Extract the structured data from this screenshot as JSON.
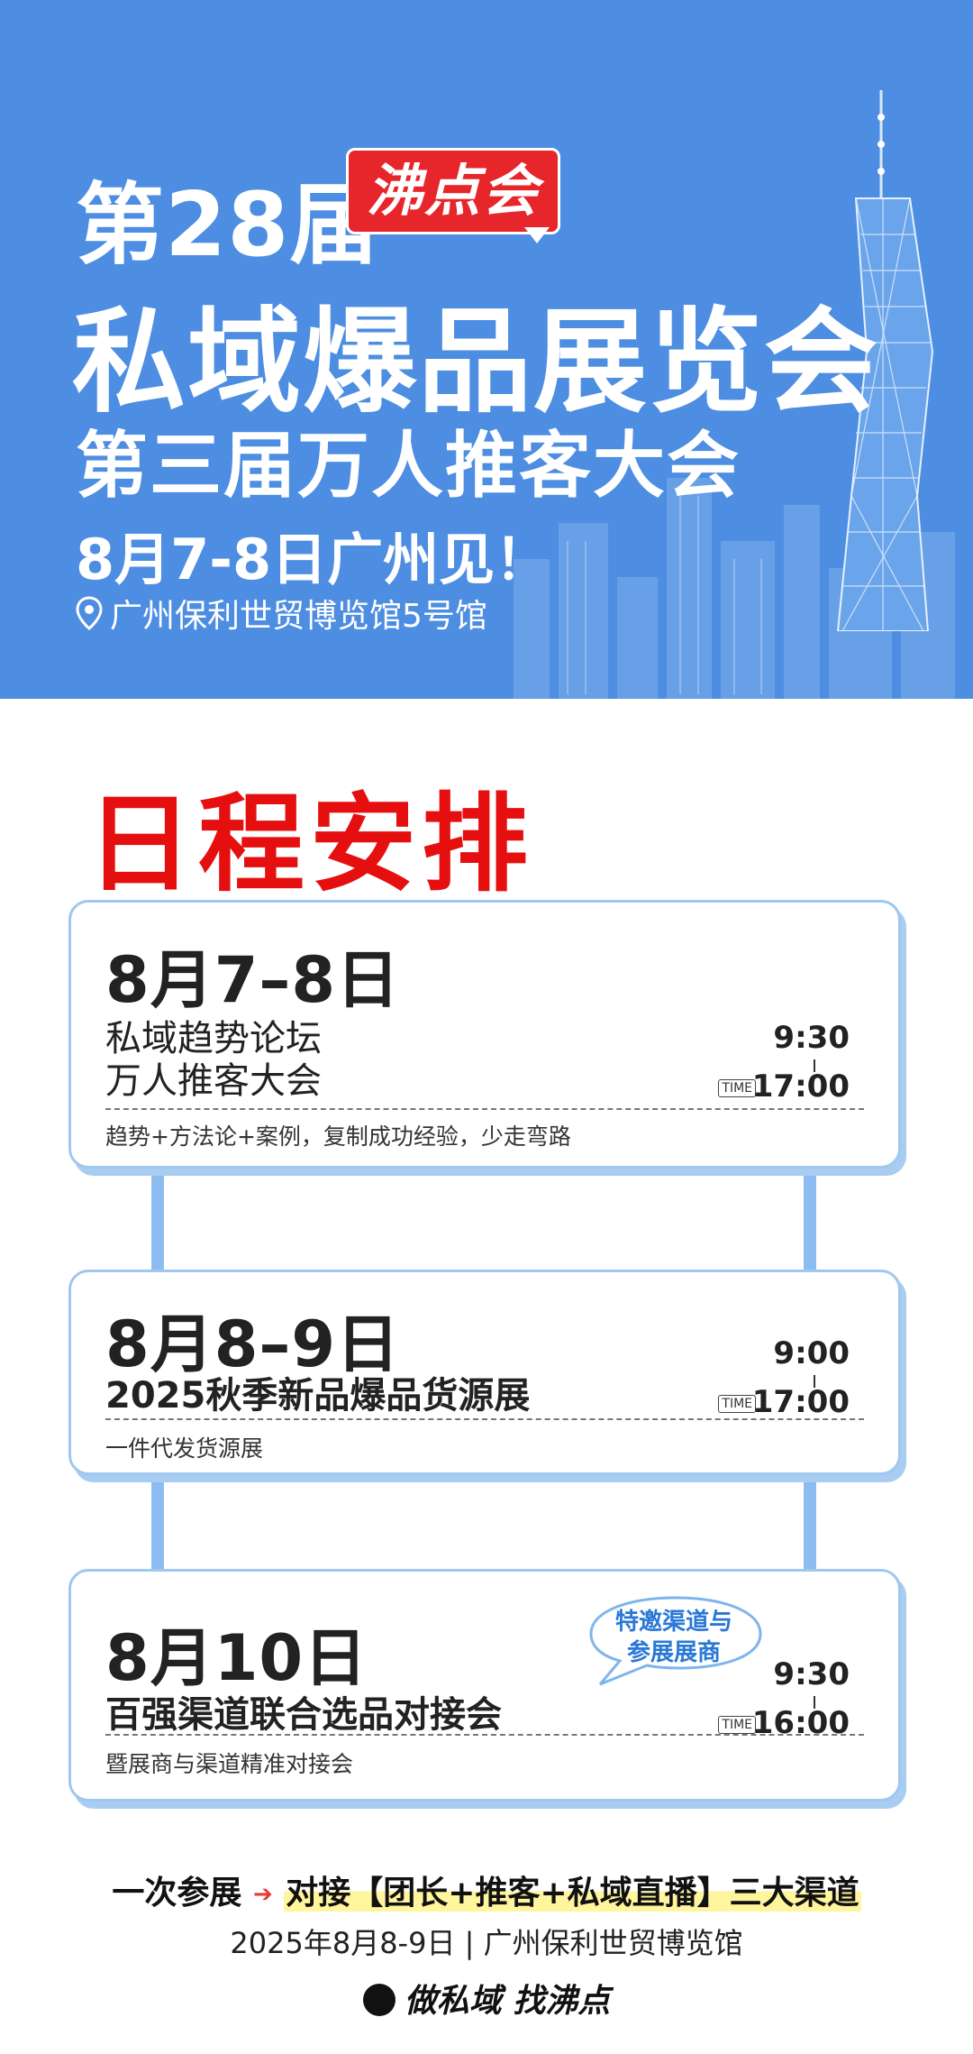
{
  "hero": {
    "edition": "第28届",
    "badge": "沸点会",
    "title": "私域爆品展览会",
    "subtitle": "第三届万人推客大会",
    "date": "8月7-8日广州见！",
    "venue": "广州保利世贸博览馆5号馆"
  },
  "schedule": {
    "title": "日程安排",
    "time_tag": "TIME",
    "cards": [
      {
        "date": "8月7–8日",
        "lines": [
          "私域趋势论坛",
          "万人推客大会"
        ],
        "start": "9:30",
        "end": "17:00",
        "note": "趋势+方法论+案例，复制成功经验，少走弯路"
      },
      {
        "date": "8月8–9日",
        "lines": [
          "2025秋季新品爆品货源展"
        ],
        "start": "9:00",
        "end": "17:00",
        "note": "一件代发货源展"
      },
      {
        "date": "8月10日",
        "lines": [
          "百强渠道联合选品对接会"
        ],
        "start": "9:30",
        "end": "16:00",
        "note": "暨展商与渠道精准对接会",
        "bubble": [
          "特邀渠道与",
          "参展展商"
        ]
      }
    ]
  },
  "footer": {
    "prefix": "一次参展",
    "highlight": "对接【团长+推客+私域直播】三大渠道",
    "info": "2025年8月8-9日 | 广州保利世贸博览馆",
    "slogan": "做私域 找沸点"
  },
  "colors": {
    "hero_bg": "#4d8de2",
    "badge_red": "#e7262b",
    "schedule_title_red": "#e60f0f",
    "card_border": "#9fc7ef",
    "bubble_text": "#2a78d6"
  }
}
